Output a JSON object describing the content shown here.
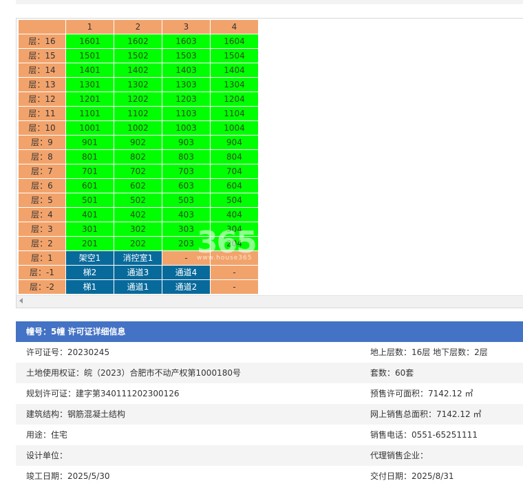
{
  "header": {
    "columns": [
      "1",
      "2",
      "3",
      "4"
    ]
  },
  "floors": [
    {
      "label": "层：16",
      "units": [
        "1601",
        "1602",
        "1603",
        "1604"
      ]
    },
    {
      "label": "层：15",
      "units": [
        "1501",
        "1502",
        "1503",
        "1504"
      ]
    },
    {
      "label": "层：14",
      "units": [
        "1401",
        "1402",
        "1403",
        "1404"
      ]
    },
    {
      "label": "层：13",
      "units": [
        "1301",
        "1302",
        "1303",
        "1304"
      ]
    },
    {
      "label": "层：12",
      "units": [
        "1201",
        "1202",
        "1203",
        "1204"
      ]
    },
    {
      "label": "层：11",
      "units": [
        "1101",
        "1102",
        "1103",
        "1104"
      ]
    },
    {
      "label": "层：10",
      "units": [
        "1001",
        "1002",
        "1003",
        "1004"
      ]
    },
    {
      "label": "层：9",
      "units": [
        "901",
        "902",
        "903",
        "904"
      ]
    },
    {
      "label": "层：8",
      "units": [
        "801",
        "802",
        "803",
        "804"
      ]
    },
    {
      "label": "层：7",
      "units": [
        "701",
        "702",
        "703",
        "704"
      ]
    },
    {
      "label": "层：6",
      "units": [
        "601",
        "602",
        "603",
        "604"
      ]
    },
    {
      "label": "层：5",
      "units": [
        "501",
        "502",
        "503",
        "504"
      ]
    },
    {
      "label": "层：4",
      "units": [
        "401",
        "402",
        "403",
        "404"
      ]
    },
    {
      "label": "层：3",
      "units": [
        "301",
        "302",
        "303",
        "304"
      ]
    },
    {
      "label": "层：2",
      "units": [
        "201",
        "202",
        "203",
        "204"
      ]
    },
    {
      "label": "层：1",
      "units": [
        "架空1",
        "消控室1",
        "-",
        ""
      ]
    },
    {
      "label": "层：-1",
      "units": [
        "梯2",
        "通道3",
        "通道4",
        "-"
      ]
    },
    {
      "label": "层：-2",
      "units": [
        "梯1",
        "通道1",
        "通道2",
        "-"
      ]
    }
  ],
  "cell_styles": [
    [
      "green",
      "green",
      "green",
      "green"
    ],
    [
      "green",
      "green",
      "green",
      "green"
    ],
    [
      "green",
      "green",
      "green",
      "green"
    ],
    [
      "green",
      "green",
      "green",
      "green"
    ],
    [
      "green",
      "green",
      "green",
      "green"
    ],
    [
      "green",
      "green",
      "green",
      "green"
    ],
    [
      "green",
      "green",
      "green",
      "green"
    ],
    [
      "green",
      "green",
      "green",
      "green"
    ],
    [
      "green",
      "green",
      "green",
      "green"
    ],
    [
      "green",
      "green",
      "green",
      "green"
    ],
    [
      "green",
      "green",
      "green",
      "green"
    ],
    [
      "green",
      "green",
      "green",
      "green"
    ],
    [
      "green",
      "green",
      "green",
      "green"
    ],
    [
      "green",
      "green",
      "green",
      "green"
    ],
    [
      "green",
      "green",
      "green",
      "green"
    ],
    [
      "blue",
      "blue",
      "orange",
      "orange"
    ],
    [
      "blue",
      "blue",
      "blue",
      "orange"
    ],
    [
      "blue",
      "blue",
      "blue",
      "orange"
    ]
  ],
  "colors": {
    "available": "#00ff00",
    "special": "#086a9b",
    "label": "#f2a36b",
    "panel_header": "#4472c4"
  },
  "watermark": {
    "text": "365",
    "sub": "www.house365"
  },
  "license": {
    "title": "幢号：5幢 许可证详细信息",
    "rows": [
      {
        "left": "许可证号：20230245",
        "right": "地上层数：16层  地下层数：2层"
      },
      {
        "left": "土地使用权证：皖（2023）合肥市不动产权第1000180号",
        "right": "套数：60套"
      },
      {
        "left": "规划许可证：建字第340111202300126",
        "right": "预售许可面积：7142.12 ㎡"
      },
      {
        "left": "建筑结构：钢筋混凝土结构",
        "right": "网上销售总面积：7142.12 ㎡"
      },
      {
        "left": "用途：住宅",
        "right": "销售电话：0551-65251111"
      },
      {
        "left": "设计单位：",
        "right": "代理销售企业："
      },
      {
        "left": "竣工日期：2025/5/30",
        "right": "交付日期：2025/8/31"
      }
    ]
  }
}
